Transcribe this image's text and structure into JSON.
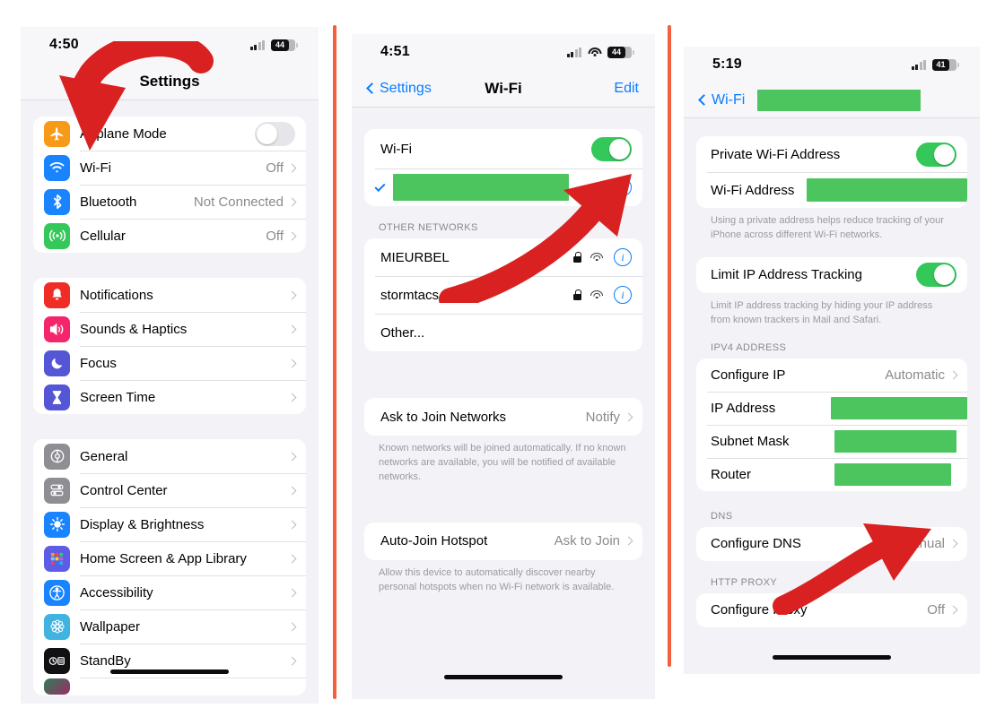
{
  "separator_color": "#F4603E",
  "annotation_color": "#D92121",
  "redaction_color": "#4CC55E",
  "accent_color": "#0A7CFF",
  "toggle_on_color": "#34C759",
  "panel1": {
    "status": {
      "time": "4:50",
      "battery": "44",
      "wifi_visible": false
    },
    "nav": {
      "title": "Settings"
    },
    "group1": [
      {
        "label": "Airplane Mode",
        "icon": "airplane-icon",
        "icon_color": "#F79A18",
        "control": "toggle-off"
      },
      {
        "label": "Wi-Fi",
        "icon": "wifi-icon",
        "icon_color": "#1A84FF",
        "value": "Off",
        "control": "chevron"
      },
      {
        "label": "Bluetooth",
        "icon": "bluetooth-icon",
        "icon_color": "#1A84FF",
        "value": "Not Connected",
        "control": "chevron"
      },
      {
        "label": "Cellular",
        "icon": "cellular-icon",
        "icon_color": "#34C759",
        "value": "Off",
        "control": "chevron"
      }
    ],
    "group2": [
      {
        "label": "Notifications",
        "icon": "bell-icon",
        "icon_color": "#F02C26",
        "control": "chevron"
      },
      {
        "label": "Sounds & Haptics",
        "icon": "speaker-icon",
        "icon_color": "#F4256B",
        "control": "chevron"
      },
      {
        "label": "Focus",
        "icon": "moon-icon",
        "icon_color": "#5456D6",
        "control": "chevron"
      },
      {
        "label": "Screen Time",
        "icon": "hourglass-icon",
        "icon_color": "#5456D6",
        "control": "chevron"
      }
    ],
    "group3": [
      {
        "label": "General",
        "icon": "gear-icon",
        "icon_color": "#8E8E93",
        "control": "chevron"
      },
      {
        "label": "Control Center",
        "icon": "sliders-icon",
        "icon_color": "#8E8E93",
        "control": "chevron"
      },
      {
        "label": "Display & Brightness",
        "icon": "brightness-icon",
        "icon_color": "#1A84FF",
        "control": "chevron"
      },
      {
        "label": "Home Screen & App Library",
        "icon": "app-grid-icon",
        "icon_color": "#5E5CE6",
        "control": "chevron"
      },
      {
        "label": "Accessibility",
        "icon": "accessibility-icon",
        "icon_color": "#1A84FF",
        "control": "chevron"
      },
      {
        "label": "Wallpaper",
        "icon": "flower-icon",
        "icon_color": "#41B3E0",
        "control": "chevron"
      },
      {
        "label": "StandBy",
        "icon": "standby-icon",
        "icon_color": "#111113",
        "control": "chevron"
      }
    ]
  },
  "panel2": {
    "status": {
      "time": "4:51",
      "battery": "44",
      "wifi_visible": true
    },
    "nav": {
      "back": "Settings",
      "title": "Wi-Fi",
      "action": "Edit"
    },
    "wifi_toggle": {
      "label": "Wi-Fi",
      "state": "on"
    },
    "connected_network": {
      "name_redacted": true
    },
    "other_header": "OTHER NETWORKS",
    "other_networks": [
      {
        "name": "MIEURBEL",
        "secured": true,
        "signal": true,
        "info": true
      },
      {
        "name": "stormtacs",
        "secured": true,
        "signal": true,
        "info": true
      },
      {
        "name": "Other...",
        "secured": false,
        "signal": false,
        "info": false
      }
    ],
    "ask_to_join": {
      "label": "Ask to Join Networks",
      "value": "Notify"
    },
    "ask_footnote": "Known networks will be joined automatically. If no known networks are available, you will be notified of available networks.",
    "auto_join": {
      "label": "Auto-Join Hotspot",
      "value": "Ask to Join"
    },
    "auto_footnote": "Allow this device to automatically discover nearby personal hotspots when no Wi-Fi network is available."
  },
  "panel3": {
    "status": {
      "time": "5:19",
      "battery": "41",
      "wifi_visible": false
    },
    "nav": {
      "back": "Wi-Fi",
      "title_redacted": true
    },
    "privacy_group": [
      {
        "label": "Private Wi-Fi Address",
        "control": "toggle-on"
      },
      {
        "label": "Wi-Fi Address",
        "control": "redacted"
      }
    ],
    "privacy_footnote": "Using a private address helps reduce tracking of your iPhone across different Wi-Fi networks.",
    "limit_group": [
      {
        "label": "Limit IP Address Tracking",
        "control": "toggle-on"
      }
    ],
    "limit_footnote": "Limit IP address tracking by hiding your IP address from known trackers in Mail and Safari.",
    "ipv4_header": "IPV4 ADDRESS",
    "ipv4_rows": [
      {
        "label": "Configure IP",
        "value": "Automatic",
        "control": "chevron"
      },
      {
        "label": "IP Address",
        "control": "redacted",
        "redact_width": 152
      },
      {
        "label": "Subnet Mask",
        "control": "redacted",
        "redact_width": 136
      },
      {
        "label": "Router",
        "control": "redacted",
        "redact_width": 130
      }
    ],
    "dns_header": "DNS",
    "dns_rows": [
      {
        "label": "Configure DNS",
        "value": "Manual",
        "control": "chevron"
      }
    ],
    "proxy_header": "HTTP PROXY",
    "proxy_rows": [
      {
        "label": "Configure Proxy",
        "value": "Off",
        "control": "chevron"
      }
    ]
  }
}
